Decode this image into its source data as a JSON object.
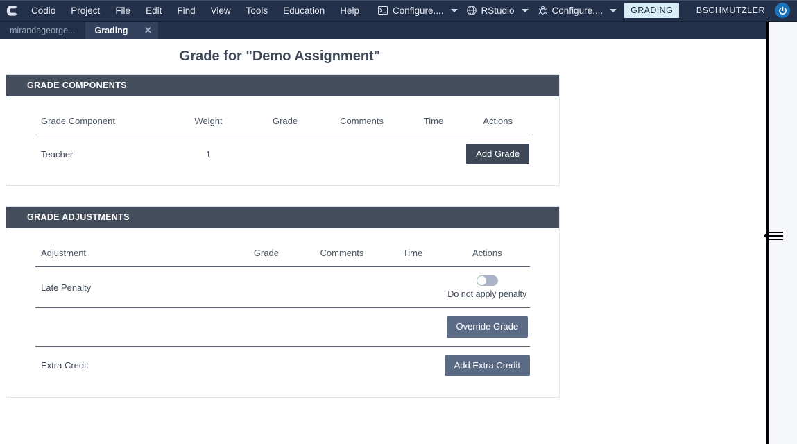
{
  "menubar": {
    "logo_icon": "codio-logo-icon",
    "items": [
      {
        "label": "Codio"
      },
      {
        "label": "Project"
      },
      {
        "label": "File"
      },
      {
        "label": "Edit"
      },
      {
        "label": "Find"
      },
      {
        "label": "View"
      },
      {
        "label": "Tools"
      },
      {
        "label": "Education"
      },
      {
        "label": "Help"
      }
    ],
    "tool_buttons": [
      {
        "label": "Configure....",
        "icon": "terminal-icon",
        "caret": "chevron-down-icon"
      },
      {
        "label": "RStudio",
        "icon": "globe-icon",
        "caret": "chevron-down-icon"
      },
      {
        "label": "Configure....",
        "icon": "bug-icon",
        "caret": "chevron-down-icon"
      }
    ],
    "grading_badge": "GRADING",
    "username": "BSCHMUTZLER",
    "power_icon": "power-icon",
    "colors": {
      "bar_bg": "#22304a",
      "badge_bg": "#d8ecf7",
      "power_bg": "#1b72b8"
    }
  },
  "tabs": [
    {
      "label": "mirandageorge...",
      "active": false,
      "closeable": false
    },
    {
      "label": "Grading",
      "active": true,
      "closeable": true,
      "close_icon": "close-icon"
    }
  ],
  "main": {
    "title": "Grade for \"Demo Assignment\"",
    "panels": [
      {
        "header": "GRADE COMPONENTS",
        "columns": [
          "Grade Component",
          "Weight",
          "Grade",
          "Comments",
          "Time",
          "Actions"
        ],
        "rows": [
          {
            "component": "Teacher",
            "weight": "1",
            "grade": "",
            "comments": "",
            "time": "",
            "action_label": "Add Grade"
          }
        ]
      },
      {
        "header": "GRADE ADJUSTMENTS",
        "columns": [
          "Adjustment",
          "Grade",
          "Comments",
          "Time",
          "Actions"
        ],
        "rows": [
          {
            "adjustment": "Late Penalty",
            "grade": "",
            "comments": "",
            "time": "",
            "toggle": {
              "state": "off",
              "label": "Do not apply penalty"
            }
          },
          {
            "adjustment": "",
            "grade": "",
            "comments": "",
            "time": "",
            "action_label": "Override Grade"
          },
          {
            "adjustment": "Extra Credit",
            "grade": "",
            "comments": "",
            "time": "",
            "action_label": "Add Extra Credit"
          }
        ]
      }
    ]
  },
  "right_panel": {
    "handle_icon": "collapse-panel-icon"
  },
  "colors": {
    "panel_header_bg": "#434d5c",
    "button_dark": "#3e4857",
    "button_slate": "#5b6a85",
    "title_text": "#3e4857"
  }
}
